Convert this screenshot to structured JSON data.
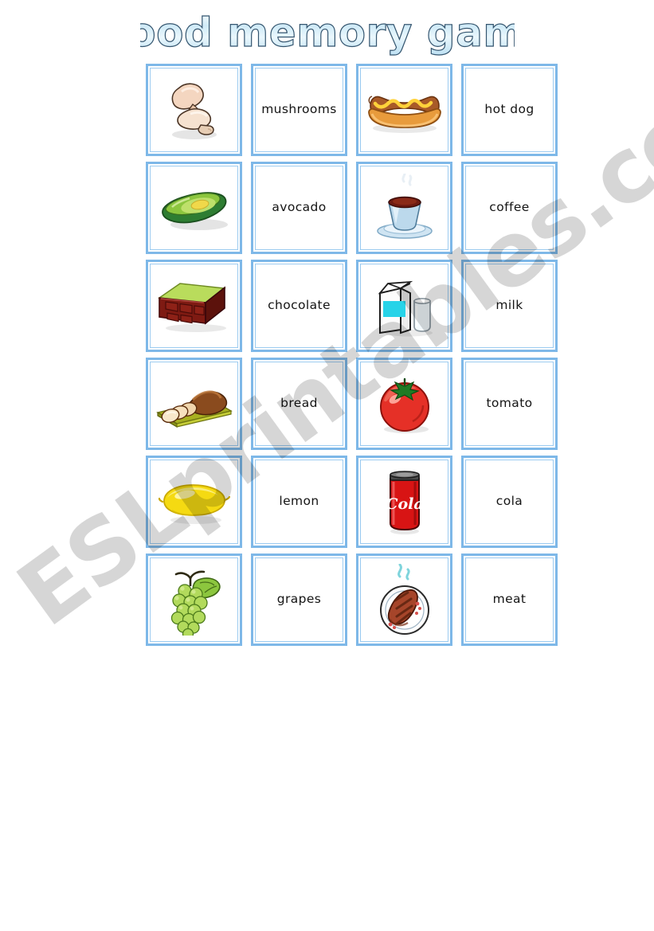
{
  "page": {
    "title": "Food memory game",
    "watermark": "ESLprintables.com",
    "background_color": "#ffffff"
  },
  "theme": {
    "card_border_color": "#7EB8E8",
    "card_inner_border_color": "#9CCBF0",
    "title_fill_color": "#D6EEF8",
    "title_stroke_color": "#3C5A78",
    "label_text_color": "#141414",
    "watermark_color": "#BFBFBF"
  },
  "grid": {
    "columns": 4,
    "rows": 6,
    "cells": [
      {
        "kind": "image",
        "icon": "mushrooms-icon",
        "label": "mushrooms"
      },
      {
        "kind": "text",
        "icon": "",
        "label": "mushrooms"
      },
      {
        "kind": "image",
        "icon": "hot-dog-icon",
        "label": "hot dog"
      },
      {
        "kind": "text",
        "icon": "",
        "label": "hot dog"
      },
      {
        "kind": "image",
        "icon": "avocado-icon",
        "label": "avocado"
      },
      {
        "kind": "text",
        "icon": "",
        "label": "avocado"
      },
      {
        "kind": "image",
        "icon": "coffee-icon",
        "label": "coffee"
      },
      {
        "kind": "text",
        "icon": "",
        "label": "coffee"
      },
      {
        "kind": "image",
        "icon": "chocolate-icon",
        "label": "chocolate"
      },
      {
        "kind": "text",
        "icon": "",
        "label": "chocolate"
      },
      {
        "kind": "image",
        "icon": "milk-icon",
        "label": "milk"
      },
      {
        "kind": "text",
        "icon": "",
        "label": "milk"
      },
      {
        "kind": "image",
        "icon": "bread-icon",
        "label": "bread"
      },
      {
        "kind": "text",
        "icon": "",
        "label": "bread"
      },
      {
        "kind": "image",
        "icon": "tomato-icon",
        "label": "tomato"
      },
      {
        "kind": "text",
        "icon": "",
        "label": "tomato"
      },
      {
        "kind": "image",
        "icon": "lemon-icon",
        "label": "lemon"
      },
      {
        "kind": "text",
        "icon": "",
        "label": "lemon"
      },
      {
        "kind": "image",
        "icon": "cola-icon",
        "label": "cola"
      },
      {
        "kind": "text",
        "icon": "",
        "label": "cola"
      },
      {
        "kind": "image",
        "icon": "grapes-icon",
        "label": "grapes"
      },
      {
        "kind": "text",
        "icon": "",
        "label": "grapes"
      },
      {
        "kind": "image",
        "icon": "meat-icon",
        "label": "meat"
      },
      {
        "kind": "text",
        "icon": "",
        "label": "meat"
      }
    ]
  },
  "artwork_labels": {
    "cola_can_text": "Cola"
  }
}
